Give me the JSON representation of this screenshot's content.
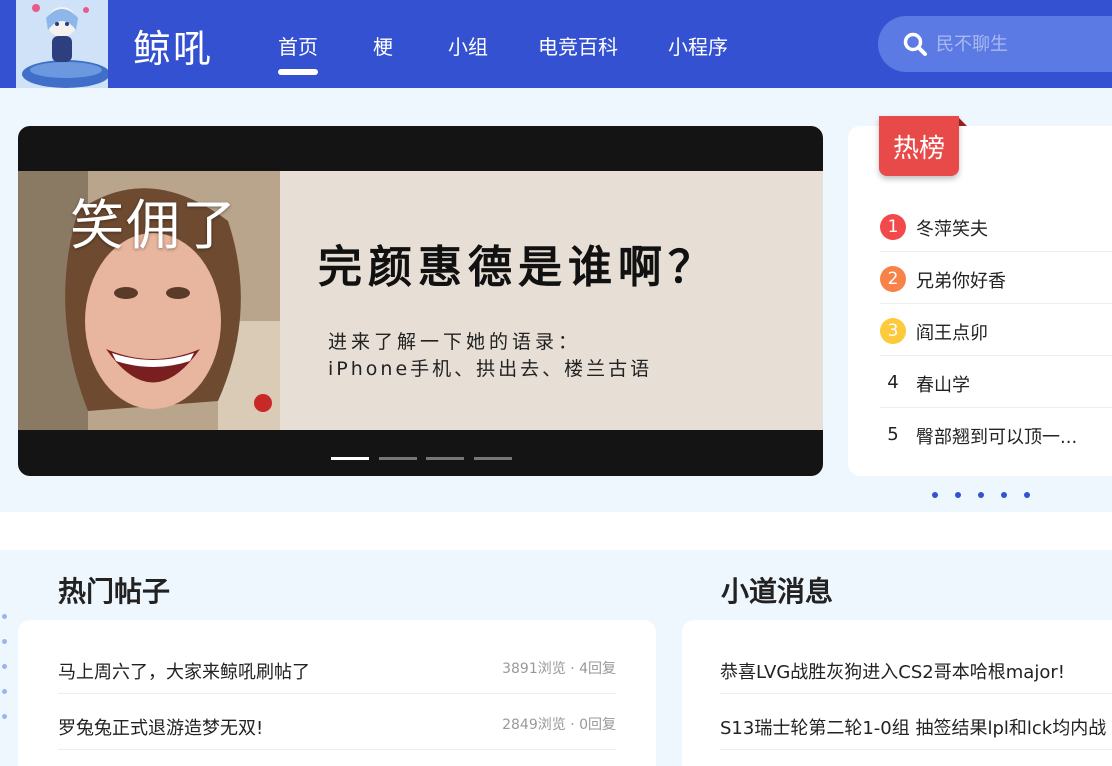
{
  "header": {
    "logo_text": "鲸吼",
    "nav": [
      {
        "label": "首页",
        "active": true
      },
      {
        "label": "梗"
      },
      {
        "label": "小组"
      },
      {
        "label": "电竞百科"
      },
      {
        "label": "小程序"
      }
    ],
    "search_placeholder": "民不聊生",
    "colors": {
      "header_bg": "#3451d1",
      "search_bg": "#5b7ae3"
    }
  },
  "banner": {
    "caption_top": "笑佣了",
    "title": "完颜惠德是谁啊？",
    "subtitle_line1": "进来了解一下她的语录：",
    "subtitle_line2": "iPhone手机、拱出去、楼兰古语",
    "slide_count": 4,
    "active_slide": 1
  },
  "hot_list": {
    "tag": "热榜",
    "items": [
      {
        "rank": "1",
        "text": "冬萍笑夫",
        "color": "#f24a4a"
      },
      {
        "rank": "2",
        "text": "兄弟你好香",
        "color": "#f7834a"
      },
      {
        "rank": "3",
        "text": "阎王点卯",
        "color": "#fcca3c"
      },
      {
        "rank": "4",
        "text": "春山学",
        "color": ""
      },
      {
        "rank": "5",
        "text": "臀部翘到可以顶一...",
        "color": ""
      }
    ],
    "page_dots": 5
  },
  "hot_posts": {
    "title": "热门帖子",
    "items": [
      {
        "title": "马上周六了，大家来鲸吼刷帖了",
        "meta": "3891浏览 · 4回复"
      },
      {
        "title": "罗兔兔正式退游造梦无双!",
        "meta": "2849浏览 · 0回复"
      }
    ]
  },
  "news": {
    "title": "小道消息",
    "items": [
      {
        "title": "恭喜LVG战胜灰狗进入CS2哥本哈根major!"
      },
      {
        "title": "S13瑞士轮第二轮1-0组 抽签结果lpl和lck均内战"
      }
    ]
  }
}
